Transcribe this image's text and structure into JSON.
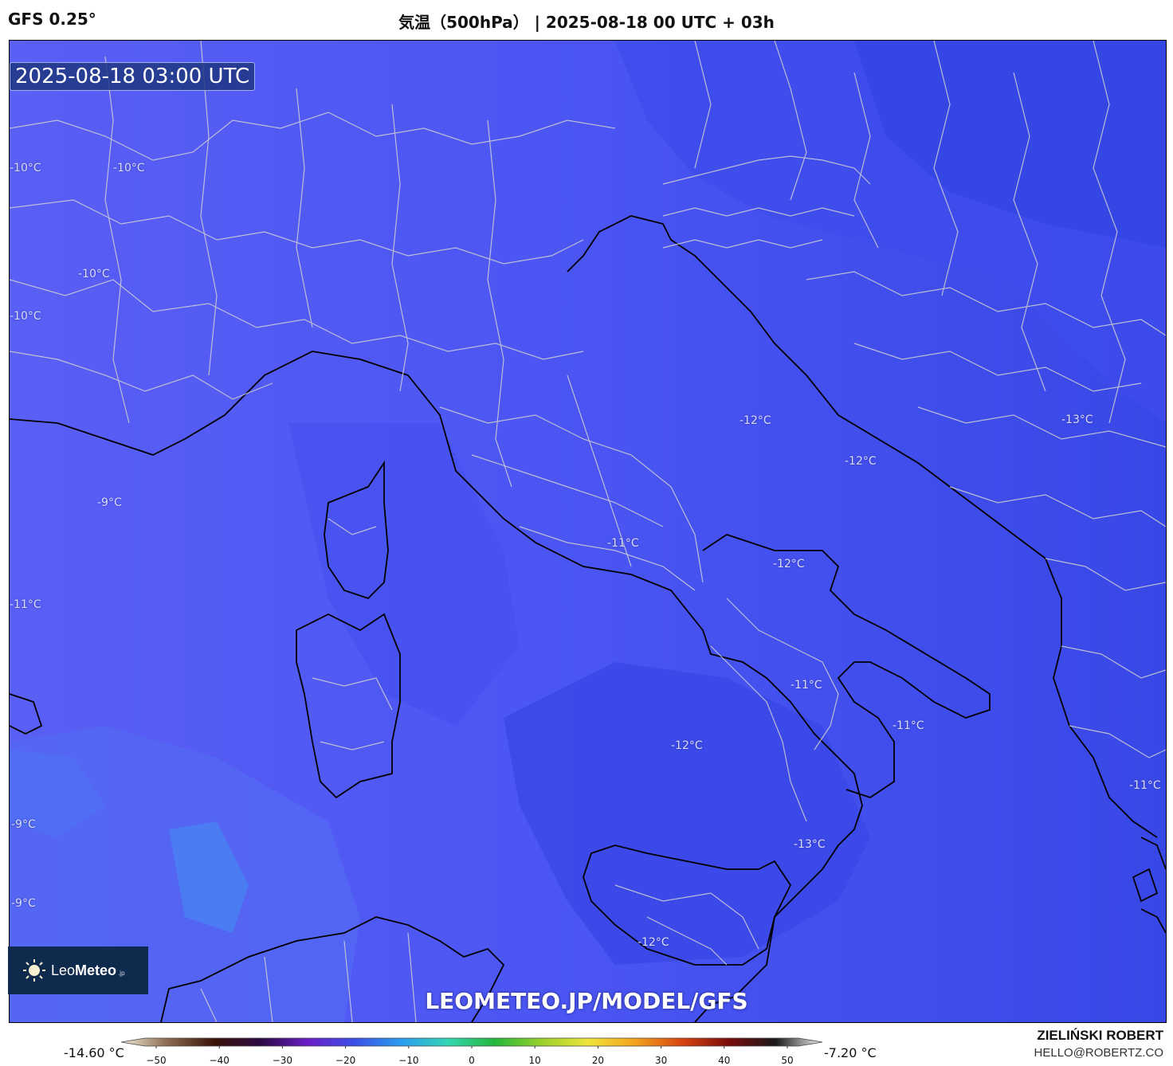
{
  "header": {
    "model": "GFS 0.25°",
    "title": "気温（500hPa） | 2025-08-18 00 UTC + 03h"
  },
  "map": {
    "valid_time": "2025-08-18 03:00 UTC",
    "temperature_labels": [
      {
        "id": "t1",
        "text": "-10°C"
      },
      {
        "id": "t2",
        "text": "-10°C"
      },
      {
        "id": "t3",
        "text": "-10°C"
      },
      {
        "id": "t4",
        "text": "-10°C"
      },
      {
        "id": "t5",
        "text": "-9°C"
      },
      {
        "id": "t6",
        "text": "-11°C"
      },
      {
        "id": "t7",
        "text": "-9°C"
      },
      {
        "id": "t8",
        "text": "-9°C"
      },
      {
        "id": "t9",
        "text": "-12°C"
      },
      {
        "id": "t10",
        "text": "-12°C"
      },
      {
        "id": "t11",
        "text": "-13°C"
      },
      {
        "id": "t12",
        "text": "-11°C"
      },
      {
        "id": "t13",
        "text": "-12°C"
      },
      {
        "id": "t14",
        "text": "-11°C"
      },
      {
        "id": "t15",
        "text": "-11°C"
      },
      {
        "id": "t16",
        "text": "-12°C"
      },
      {
        "id": "t17",
        "text": "-13°C"
      },
      {
        "id": "t18",
        "text": "-11°C"
      },
      {
        "id": "t19",
        "text": "-12°C"
      }
    ],
    "brand": {
      "text_light": "Leo",
      "text_bold": "Meteo",
      "suffix": ".jp"
    },
    "watermark": "LEOMETEO.JP/MODEL/GFS"
  },
  "colorbar": {
    "min_label": "-14.60 °C",
    "max_label": "-7.20 °C",
    "ticks": [
      "−50",
      "−40",
      "−30",
      "−20",
      "−10",
      "0",
      "10",
      "20",
      "30",
      "40",
      "50"
    ],
    "colors": [
      "#f4ecd8",
      "#8a6a50",
      "#3a1208",
      "#2c0a45",
      "#6a1fc9",
      "#3c50e6",
      "#2a9df0",
      "#33d6b4",
      "#23b83a",
      "#9ad12a",
      "#f0e43a",
      "#f2a21e",
      "#d8440f",
      "#7a0c0c",
      "#1a1a1a",
      "#f5f5f5"
    ]
  },
  "credit": {
    "name": "ZIELIŃSKI ROBERT",
    "email": "HELLO@ROBERTZ.CO"
  }
}
